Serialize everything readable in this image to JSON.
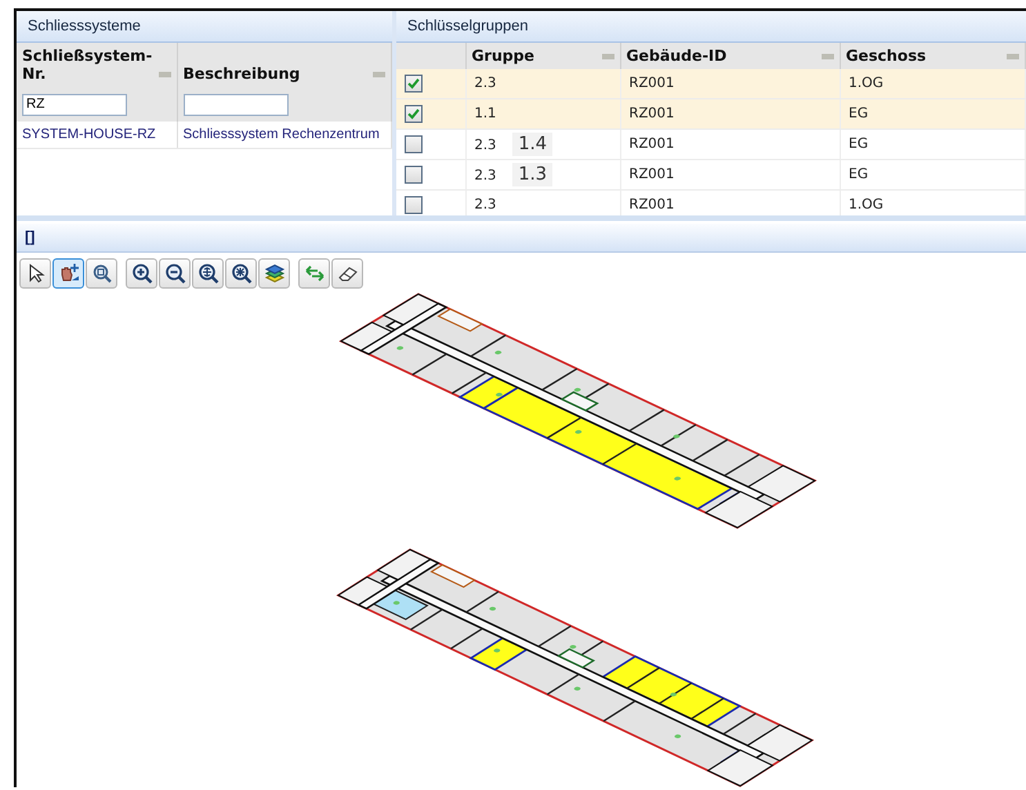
{
  "systems_panel": {
    "title": "Schliesssysteme",
    "columns": [
      {
        "label": "Schließsystem-Nr.",
        "filter": "RZ"
      },
      {
        "label": "Beschreibung"
      }
    ],
    "rows": [
      {
        "cells": [
          "SYSTEM-HOUSE-RZ",
          "Schliesssystem Rechenzentrum"
        ]
      }
    ]
  },
  "groups_panel": {
    "title": "Schlüsselgruppen",
    "columns": [
      "Gruppe",
      "Gebäude-ID",
      "Geschoss"
    ],
    "rows": [
      {
        "checked": true,
        "group": "2.3",
        "building": "RZ001",
        "floor": "1.OG"
      },
      {
        "checked": true,
        "group": "1.1",
        "building": "RZ001",
        "floor": "EG"
      },
      {
        "checked": false,
        "group": "2.3",
        "tag": "1.4",
        "building": "RZ001",
        "floor": "EG"
      },
      {
        "checked": false,
        "group": "2.3",
        "tag": "1.3",
        "building": "RZ001",
        "floor": "EG"
      },
      {
        "checked": false,
        "group": "2.3",
        "building": "RZ001",
        "floor": "1.OG"
      }
    ]
  },
  "map_panel": {
    "title": "[]",
    "tool_groups": [
      [
        {
          "kind": "pointer",
          "selected": false
        },
        {
          "kind": "pan",
          "selected": true
        },
        {
          "kind": "zoom-window",
          "selected": false
        }
      ],
      [
        {
          "kind": "zoom-in",
          "selected": false
        },
        {
          "kind": "zoom-out",
          "selected": false
        },
        {
          "kind": "zoom-extent",
          "selected": false
        },
        {
          "kind": "zoom-region",
          "selected": false
        },
        {
          "kind": "layers",
          "selected": false
        }
      ],
      [
        {
          "kind": "refresh",
          "selected": false
        },
        {
          "kind": "eraser",
          "selected": false
        }
      ]
    ]
  }
}
